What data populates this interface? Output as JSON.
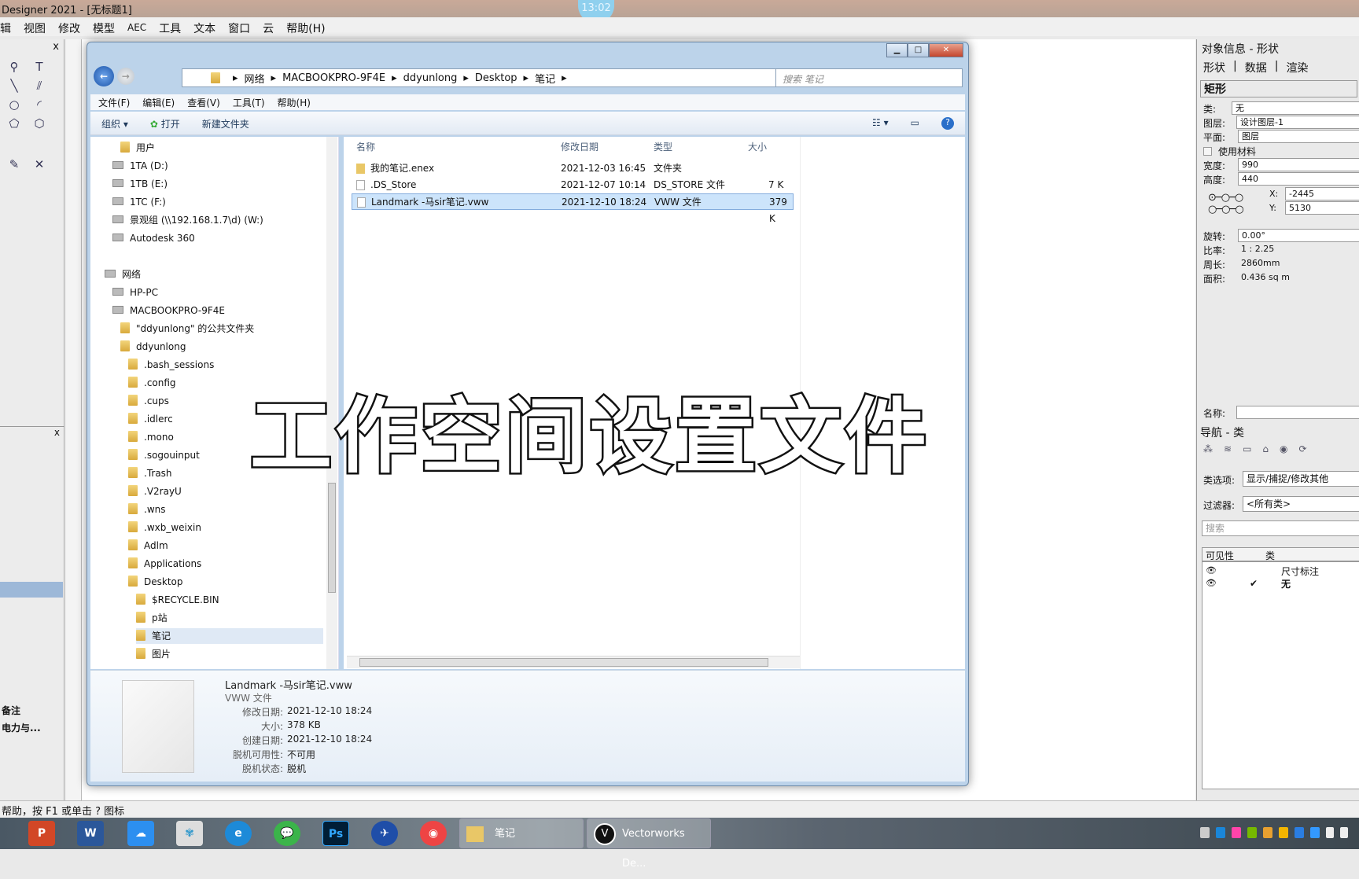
{
  "app": {
    "title": "Designer 2021 - [无标题1]",
    "clock": "13:02",
    "menu": [
      "辑",
      "视图",
      "修改",
      "模型",
      "AEC",
      "工具",
      "文本",
      "窗口",
      "云",
      "帮助(H)"
    ],
    "status": "帮助，按 F1 或单击 ? 图标",
    "left_items": [
      "备注",
      "电力与..."
    ]
  },
  "explorer": {
    "breadcrumb": [
      "网络",
      "MACBOOKPRO-9F4E",
      "ddyunlong",
      "Desktop",
      "笔记"
    ],
    "search_placeholder": "搜索 笔记",
    "menu": [
      "文件(F)",
      "编辑(E)",
      "查看(V)",
      "工具(T)",
      "帮助(H)"
    ],
    "toolbar": {
      "organize": "组织 ▾",
      "open": "打开",
      "new_folder": "新建文件夹"
    },
    "nav": [
      {
        "label": "用户",
        "type": "folder",
        "level": 2
      },
      {
        "label": "1TA (D:)",
        "type": "drive",
        "level": 1
      },
      {
        "label": "1TB (E:)",
        "type": "drive",
        "level": 1
      },
      {
        "label": "1TC (F:)",
        "type": "drive",
        "level": 1
      },
      {
        "label": "景观组 (\\\\192.168.1.7\\d) (W:)",
        "type": "net",
        "level": 1
      },
      {
        "label": "Autodesk 360",
        "type": "drive",
        "level": 1
      },
      {
        "label": "网络",
        "type": "net",
        "level": 0,
        "gap": true
      },
      {
        "label": "HP-PC",
        "type": "drive",
        "level": 1
      },
      {
        "label": "MACBOOKPRO-9F4E",
        "type": "drive",
        "level": 1
      },
      {
        "label": "\"ddyunlong\" 的公共文件夹",
        "type": "folder",
        "level": 2
      },
      {
        "label": "ddyunlong",
        "type": "folder",
        "level": 2
      },
      {
        "label": ".bash_sessions",
        "type": "folder",
        "level": 3
      },
      {
        "label": ".config",
        "type": "folder",
        "level": 3
      },
      {
        "label": ".cups",
        "type": "folder",
        "level": 3
      },
      {
        "label": ".idlerc",
        "type": "folder",
        "level": 3
      },
      {
        "label": ".mono",
        "type": "folder",
        "level": 3
      },
      {
        "label": ".sogouinput",
        "type": "folder",
        "level": 3
      },
      {
        "label": ".Trash",
        "type": "folder",
        "level": 3
      },
      {
        "label": ".V2rayU",
        "type": "folder",
        "level": 3
      },
      {
        "label": ".wns",
        "type": "folder",
        "level": 3
      },
      {
        "label": ".wxb_weixin",
        "type": "folder",
        "level": 3
      },
      {
        "label": "Adlm",
        "type": "folder",
        "level": 3
      },
      {
        "label": "Applications",
        "type": "folder",
        "level": 3
      },
      {
        "label": "Desktop",
        "type": "folder",
        "level": 3
      },
      {
        "label": "$RECYCLE.BIN",
        "type": "folder",
        "level": 4
      },
      {
        "label": "p站",
        "type": "folder",
        "level": 4
      },
      {
        "label": "笔记",
        "type": "folder",
        "level": 4,
        "selected": true
      },
      {
        "label": "图片",
        "type": "folder",
        "level": 4
      }
    ],
    "columns": [
      "名称",
      "修改日期",
      "类型",
      "大小"
    ],
    "files": [
      {
        "name": "我的笔记.enex",
        "date": "2021-12-03 16:45",
        "type": "文件夹",
        "size": "",
        "folder": true
      },
      {
        "name": ".DS_Store",
        "date": "2021-12-07 10:14",
        "type": "DS_STORE 文件",
        "size": "7 K"
      },
      {
        "name": "Landmark -马sir笔记.vww",
        "date": "2021-12-10 18:24",
        "type": "VWW 文件",
        "size": "379 K",
        "selected": true
      }
    ],
    "details": {
      "name": "Landmark -马sir笔记.vww",
      "type": "VWW 文件",
      "fields": [
        {
          "label": "修改日期:",
          "value": "2021-12-10 18:24"
        },
        {
          "label": "大小:",
          "value": "378 KB"
        },
        {
          "label": "创建日期:",
          "value": "2021-12-10 18:24"
        },
        {
          "label": "脱机可用性:",
          "value": "不可用"
        },
        {
          "label": "脱机状态:",
          "value": "脱机"
        }
      ]
    }
  },
  "oip": {
    "title": "对象信息 - 形状",
    "tabs": [
      "形状",
      "数据",
      "渲染"
    ],
    "shape": "矩形",
    "fields": [
      {
        "label": "类:",
        "value": "无"
      },
      {
        "label": "图层:",
        "value": "设计图层-1"
      },
      {
        "label": "平面:",
        "value": "图层"
      }
    ],
    "use_material": "使用材料",
    "width_label": "宽度:",
    "width": "990",
    "height_label": "高度:",
    "height": "440",
    "x_label": "X:",
    "x": "-2445",
    "y_label": "Y:",
    "y": "5130",
    "rotation_label": "旋转:",
    "rotation": "0.00°",
    "ratio_label": "比率:",
    "ratio": "1 : 2.25",
    "perimeter_label": "周长:",
    "perimeter": "2860mm",
    "area_label": "面积:",
    "area": "0.436 sq m",
    "name_label": "名称:"
  },
  "nav": {
    "title": "导航 - 类",
    "class_opt_label": "类选项:",
    "class_opt": "显示/捕捉/修改其他",
    "filter_label": "过滤器:",
    "filter": "<所有类>",
    "search_placeholder": "搜索",
    "col_vis": "可见性",
    "col_class": "类",
    "classes": [
      "尺寸标注",
      "无"
    ]
  },
  "caption": "工作空间设置文件",
  "taskbar": {
    "explorer": "笔记",
    "vectorworks": "Vectorworks De..."
  }
}
